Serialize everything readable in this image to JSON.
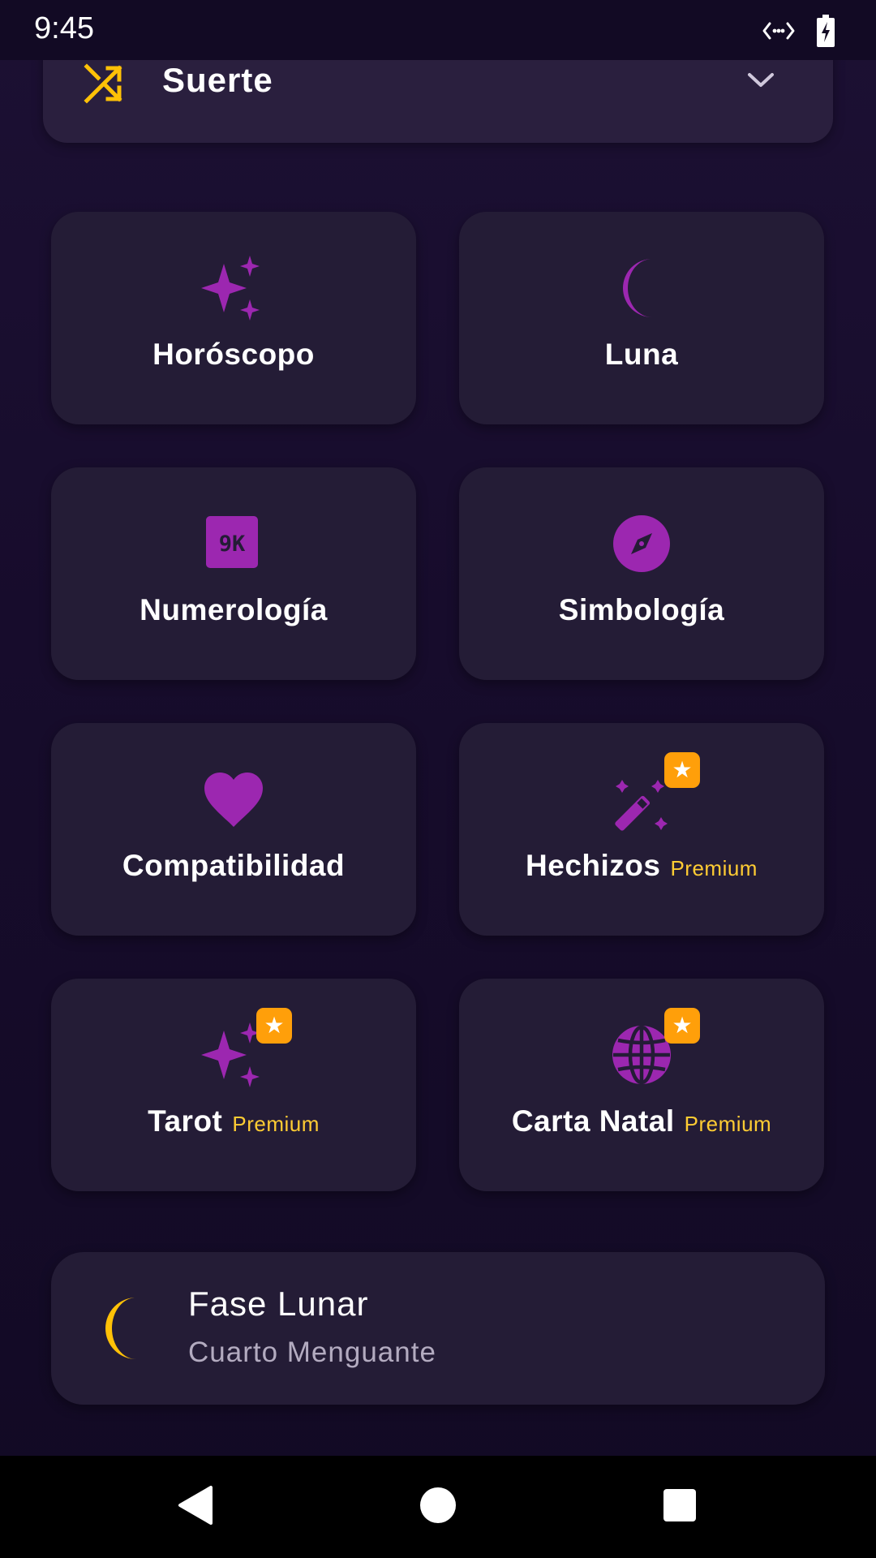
{
  "status_bar": {
    "time": "9:45",
    "icons": [
      "code-arrows-icon",
      "battery-charging-icon"
    ]
  },
  "dropdown": {
    "label": "Suerte",
    "icon": "shuffle-icon",
    "chevron": "chevron-down-icon"
  },
  "grid": {
    "premium_label": "Premium",
    "items": [
      {
        "label": "Horóscopo",
        "icon": "sparkles-icon",
        "premium": false
      },
      {
        "label": "Luna",
        "icon": "moon-icon",
        "premium": false
      },
      {
        "label": "Numerología",
        "icon": "numbers-icon",
        "icon_text": "9K",
        "premium": false
      },
      {
        "label": "Simbología",
        "icon": "compass-icon",
        "premium": false
      },
      {
        "label": "Compatibilidad",
        "icon": "heart-icon",
        "premium": false
      },
      {
        "label": "Hechizos",
        "icon": "magic-wand-icon",
        "premium": true
      },
      {
        "label": "Tarot",
        "icon": "sparkles-icon",
        "premium": true
      },
      {
        "label": "Carta Natal",
        "icon": "globe-icon",
        "premium": true
      }
    ]
  },
  "moon_phase": {
    "title": "Fase Lunar",
    "value": "Cuarto Menguante",
    "icon": "crescent-moon-icon"
  },
  "colors": {
    "accent_purple": "#9c27b0",
    "accent_yellow": "#ffc107",
    "badge_orange": "#ff9f0a",
    "premium_text": "#ffcc33",
    "card_bg": "#241c36"
  },
  "nav_bar": {
    "buttons": [
      "back-icon",
      "home-icon",
      "recents-icon"
    ]
  }
}
